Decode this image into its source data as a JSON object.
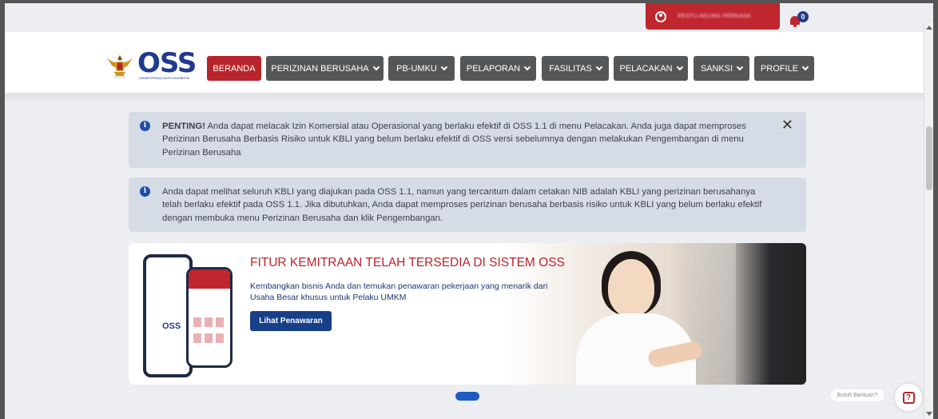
{
  "header": {
    "user_name": "RESTU AGUNG PERKASA",
    "notification_count": "0"
  },
  "logo": {
    "text": "OSS",
    "subtitle": "KEMENTERIAN INVESTASI/BKPM"
  },
  "nav": {
    "items": [
      {
        "label": "BERANDA",
        "active": true
      },
      {
        "label": "PERIZINAN BERUSAHA",
        "dropdown": true
      },
      {
        "label": "PB-UMKU",
        "dropdown": true
      },
      {
        "label": "PELAPORAN",
        "dropdown": true
      },
      {
        "label": "FASILITAS",
        "dropdown": true
      },
      {
        "label": "PELACAKAN",
        "dropdown": true
      },
      {
        "label": "SANKSI",
        "dropdown": true
      },
      {
        "label": "PROFILE",
        "dropdown": true
      }
    ]
  },
  "alerts": [
    {
      "bold": "PENTING!",
      "text": " Anda dapat melacak Izin Komersial atau Operasional yang berlaku efektif di OSS 1.1 di menu Pelacakan. Anda juga dapat memproses Perizinan Berusaha Berbasis Risiko untuk KBLI yang belum berlaku efektif di OSS versi sebelumnya dengan melakukan Pengembangan di menu Perizinan Berusaha",
      "close": "✕"
    },
    {
      "bold": "",
      "text": "Anda dapat melihat seluruh KBLI yang diajukan pada OSS 1.1, namun yang tercantum dalam cetakan NIB adalah KBLI yang perizinan berusahanya telah berlaku efektif pada OSS 1.1. Jika dibutuhkan, Anda dapat memproses perizinan berusaha berbasis risiko untuk KBLI yang belum berlaku efektif dengan membuka menu Perizinan Berusaha dan klik Pengembangan."
    }
  ],
  "banner": {
    "title": "FITUR KEMITRAAN TELAH TERSEDIA DI SISTEM OSS",
    "description": "Kembangkan bisnis Anda dan temukan penawaran pekerjaan yang menarik dari Usaha Besar khusus untuk Pelaku UMKM",
    "button": "Lihat Penawaran",
    "phone_logo": "OSS"
  },
  "help": {
    "label": "Butuh Bantuan?",
    "icon": "?"
  },
  "colors": {
    "brand_red": "#c0262d",
    "brand_blue": "#203a8f",
    "nav_gray": "#555658",
    "alert_bg": "#d6dce6"
  }
}
